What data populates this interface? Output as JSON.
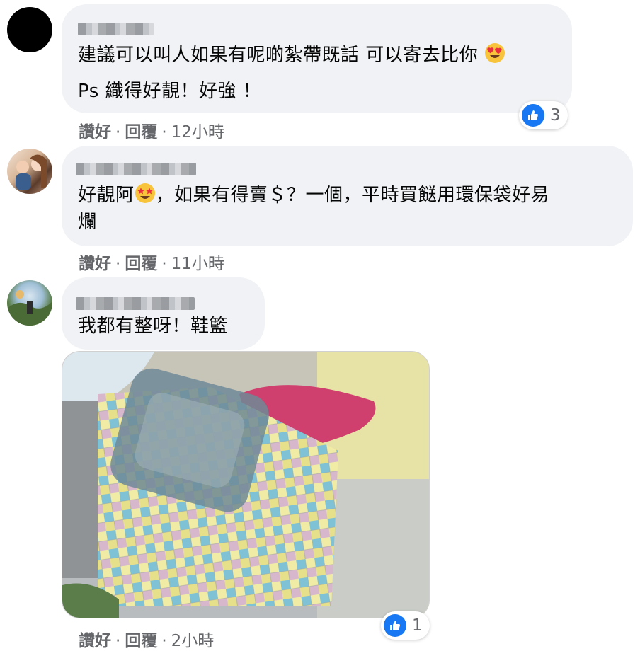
{
  "comments": [
    {
      "lines": [
        "建議可以叫人如果有呢啲紮帶既話 可以寄去比你",
        "Ps 織得好靚！好強 ！"
      ],
      "emoji": "heart-eyes-emoji",
      "like_label": "讚好",
      "reply_label": "回覆",
      "time": "12小時",
      "reaction_count": "3"
    },
    {
      "lines": [
        "好靚阿",
        "，如果有得賣＄？一個，平時買餸用環保袋好易",
        "爛"
      ],
      "emoji": "star-struck-emoji",
      "like_label": "讚好",
      "reply_label": "回覆",
      "time": "11小時",
      "reaction_count": ""
    },
    {
      "lines": [
        "我都有整呀！鞋籃"
      ],
      "like_label": "讚好",
      "reply_label": "回覆",
      "time": "2小時",
      "reaction_count": "1"
    }
  ],
  "colors": {
    "bubble": "#f0f2f5",
    "secondary_text": "#65676b",
    "like_blue": "#1877f2"
  },
  "separator": "·"
}
